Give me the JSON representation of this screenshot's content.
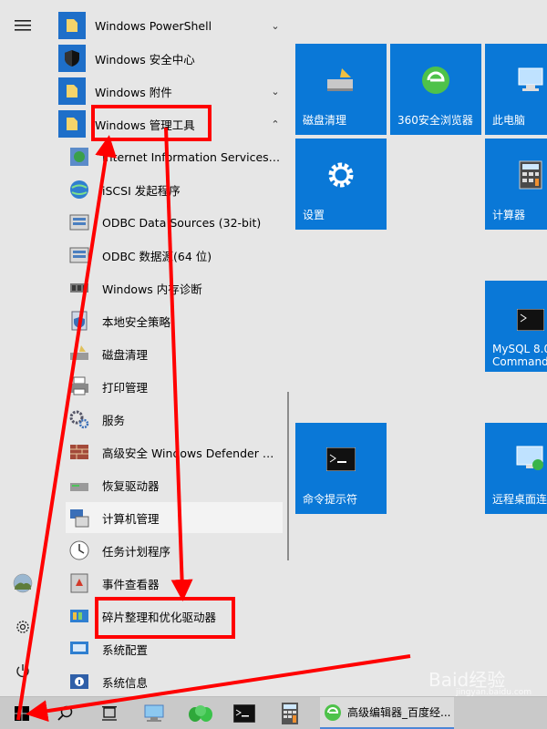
{
  "rail": {
    "icons": [
      "hamburger-menu-icon",
      "user-avatar-icon",
      "settings-gear-icon",
      "power-icon"
    ]
  },
  "apps": {
    "folders": [
      {
        "label": "Windows PowerShell",
        "chevron": "⌄"
      },
      {
        "label": "Windows 安全中心"
      },
      {
        "label": "Windows 附件",
        "chevron": "⌄"
      },
      {
        "label": "Windows 管理工具",
        "chevron": "⌃"
      }
    ],
    "items": [
      {
        "label": "Internet Information Services (II..."
      },
      {
        "label": "iSCSI 发起程序"
      },
      {
        "label": "ODBC Data Sources (32-bit)"
      },
      {
        "label": "ODBC 数据源(64 位)"
      },
      {
        "label": "Windows 内存诊断"
      },
      {
        "label": "本地安全策略"
      },
      {
        "label": "磁盘清理"
      },
      {
        "label": "打印管理"
      },
      {
        "label": "服务"
      },
      {
        "label": "高级安全 Windows Defender 防..."
      },
      {
        "label": "恢复驱动器"
      },
      {
        "label": "计算机管理"
      },
      {
        "label": "任务计划程序"
      },
      {
        "label": "事件查看器"
      },
      {
        "label": "碎片整理和优化驱动器"
      },
      {
        "label": "系统配置"
      },
      {
        "label": "系统信息"
      }
    ]
  },
  "tiles": [
    {
      "label": "磁盘清理",
      "icon": "disk-cleanup-icon"
    },
    {
      "label": "360安全浏览器",
      "icon": "browser-360-icon"
    },
    {
      "label": "此电脑",
      "icon": "this-pc-icon"
    },
    {
      "label": "设置",
      "icon": "settings-gear-icon"
    },
    {
      "label": "计算器",
      "icon": "calculator-icon"
    },
    {
      "label": "MySQL 8.0 Command",
      "icon": "mysql-icon"
    },
    {
      "label": "命令提示符",
      "icon": "cmd-icon"
    },
    {
      "label": "远程桌面连",
      "icon": "remote-desktop-icon"
    }
  ],
  "taskbar": {
    "active_label": "高级编辑器_百度经...",
    "icons": [
      "start-icon",
      "search-icon",
      "task-view-icon",
      "network-pc-icon",
      "leaf-app-icon",
      "cmd-icon",
      "calculator-icon",
      "browser-360-icon"
    ]
  },
  "watermark": {
    "text": "Baid经验",
    "sub": "jingyan.baidu.com"
  },
  "colors": {
    "tile": "#0a78d7",
    "annotation": "#ff0000",
    "folder": "#1e6fc9"
  }
}
